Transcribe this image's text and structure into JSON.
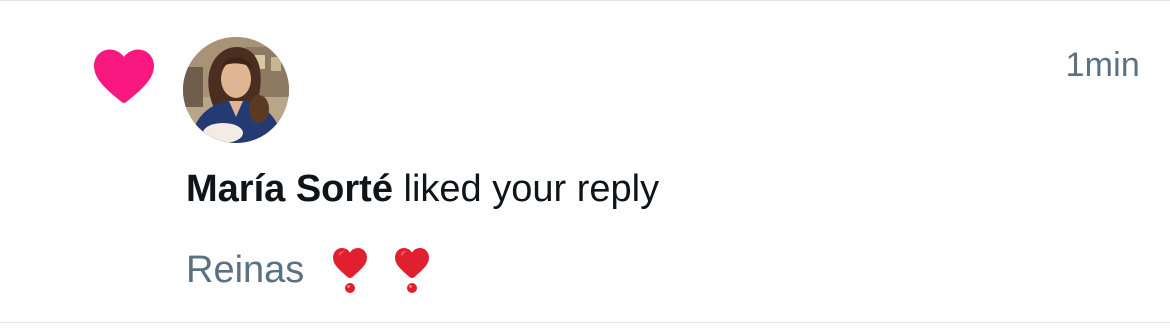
{
  "notification": {
    "type_icon": "heart-icon",
    "accent_color": "#f91880",
    "avatar_alt": "María Sorté",
    "user_name": "María Sorté",
    "action_text": " liked your reply",
    "timestamp": "1min",
    "reply_text": "Reinas",
    "reply_emojis": [
      "heavy-heart-exclamation-icon",
      "heavy-heart-exclamation-icon"
    ]
  }
}
